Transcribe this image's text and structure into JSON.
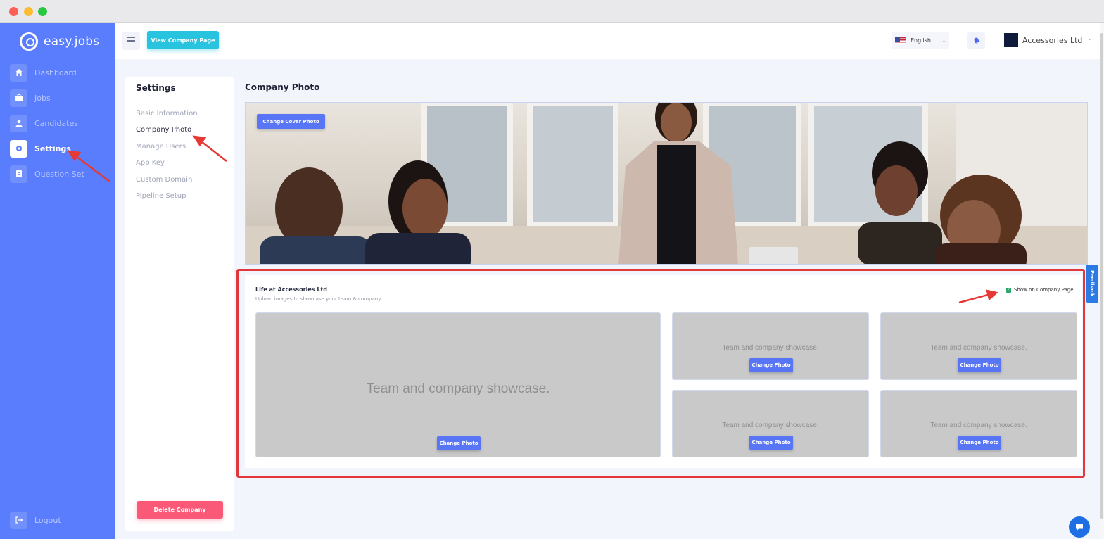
{
  "brand": {
    "name": "easy.jobs"
  },
  "sidebar": {
    "items": [
      {
        "label": "Dashboard",
        "icon": "home-icon"
      },
      {
        "label": "Jobs",
        "icon": "briefcase-icon"
      },
      {
        "label": "Candidates",
        "icon": "user-icon"
      },
      {
        "label": "Settings",
        "icon": "gear-icon",
        "active": true
      },
      {
        "label": "Question Set",
        "icon": "document-icon"
      }
    ],
    "logout": "Logout"
  },
  "topbar": {
    "view_company_page": "View Company Page",
    "language": "English",
    "company_name": "Accessories Ltd"
  },
  "settings": {
    "title": "Settings",
    "links": [
      {
        "label": "Basic Information"
      },
      {
        "label": "Company Photo",
        "active": true
      },
      {
        "label": "Manage Users"
      },
      {
        "label": "App Key"
      },
      {
        "label": "Custom Domain"
      },
      {
        "label": "Pipeline Setup"
      }
    ],
    "delete_company": "Delete Company"
  },
  "main": {
    "title": "Company Photo",
    "cover_button": "Change Cover Photo",
    "life": {
      "title": "Life at Accessories Ltd",
      "subtitle": "Upload images to showcase your team & company.",
      "show_on_company_page": "Show on Company Page",
      "show_checked": true,
      "tiles": [
        {
          "placeholder": "Team and company showcase.",
          "button": "Change Photo"
        },
        {
          "placeholder": "Team and company showcase.",
          "button": "Change Photo"
        },
        {
          "placeholder": "Team and company showcase.",
          "button": "Change Photo"
        },
        {
          "placeholder": "Team and company showcase.",
          "button": "Change Photo"
        },
        {
          "placeholder": "Team and company showcase.",
          "button": "Change Photo"
        }
      ]
    }
  },
  "feedback": "Feedback",
  "colors": {
    "sidebar": "#597dfc",
    "primary_button": "#5875f5",
    "view_button": "#28c3df",
    "danger": "#fa5a78",
    "highlight": "#e2373c"
  }
}
